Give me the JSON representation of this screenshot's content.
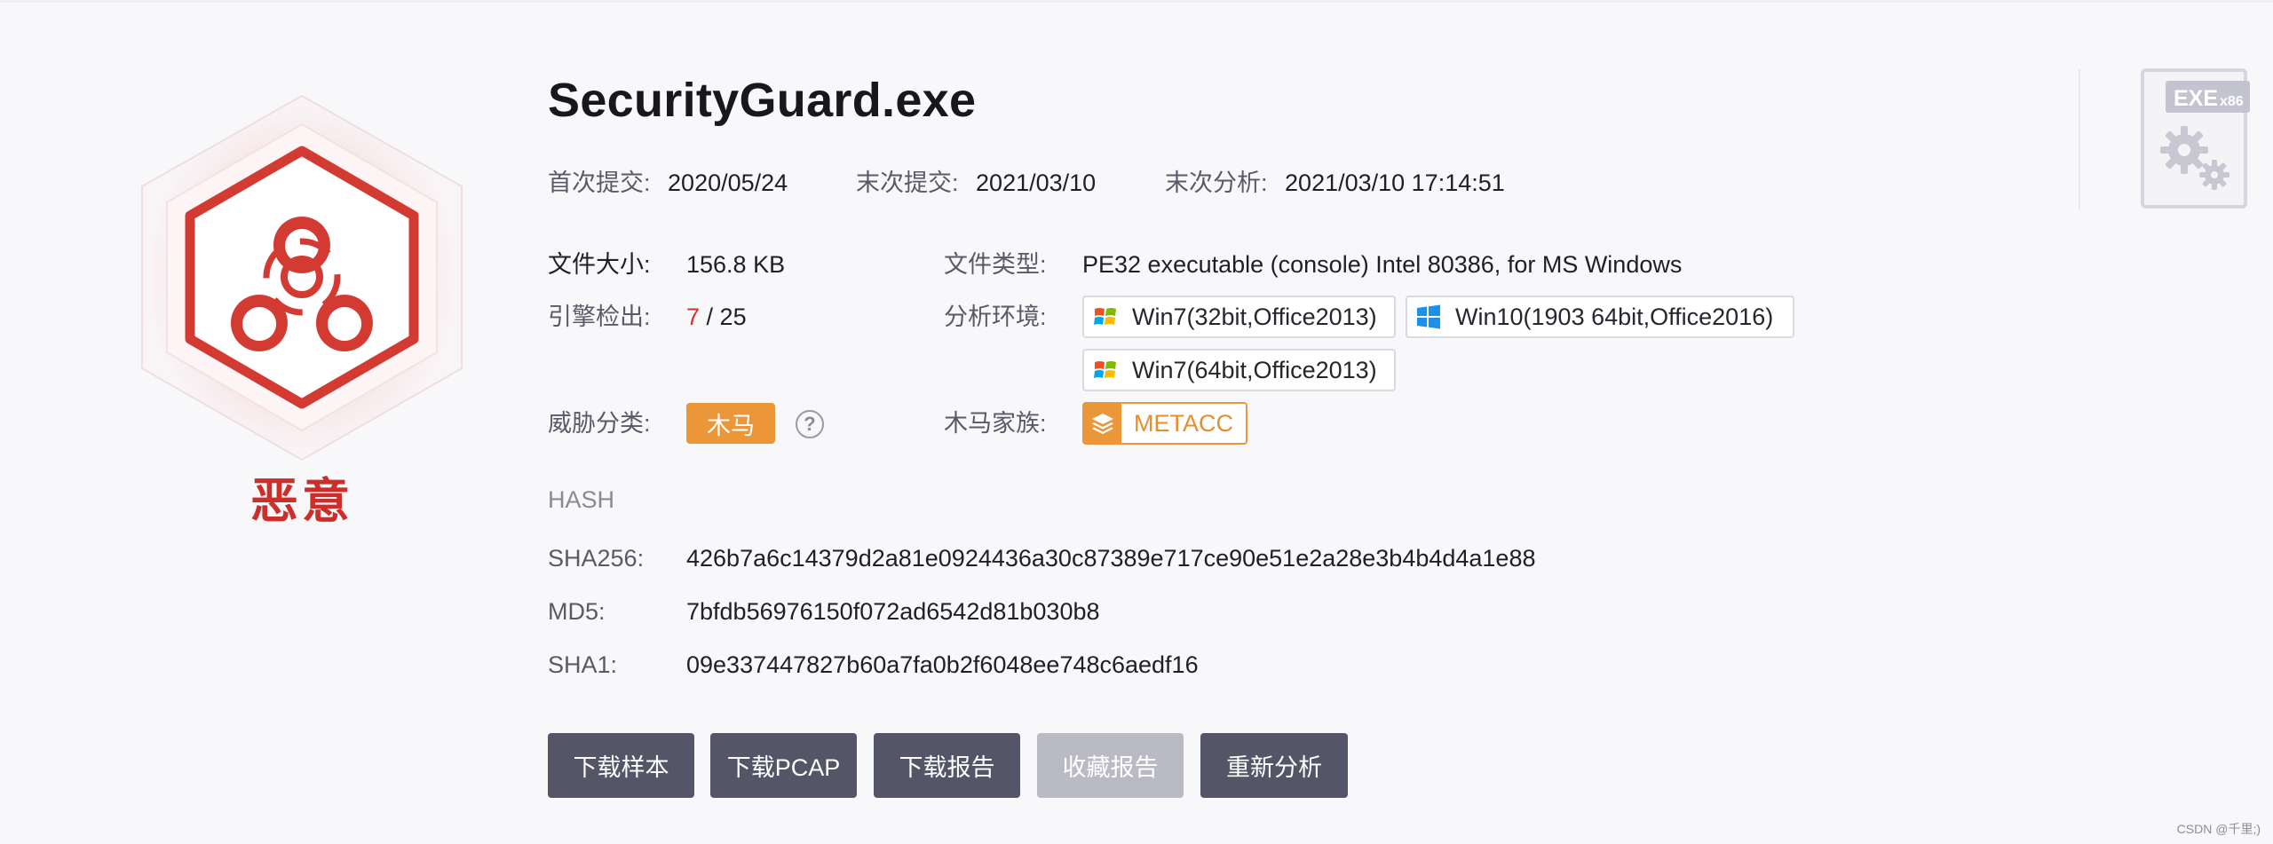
{
  "file": {
    "name": "SecurityGuard.exe"
  },
  "verdict": {
    "label": "恶意",
    "icon": "biohazard-icon",
    "color": "#cc2e2a"
  },
  "submission": {
    "first_label": "首次提交:",
    "first_value": "2020/05/24",
    "last_label": "末次提交:",
    "last_value": "2021/03/10",
    "analysis_label": "末次分析:",
    "analysis_value": "2021/03/10 17:14:51"
  },
  "details": {
    "size_label": "文件大小:",
    "size_value": "156.8 KB",
    "type_label": "文件类型:",
    "type_value": "PE32 executable (console) Intel 80386, for MS Windows",
    "engine_label": "引擎检出:",
    "engine_detected": "7",
    "engine_sep": " / ",
    "engine_total": "25",
    "env_label": "分析环境:",
    "environments": [
      {
        "label": "Win7(32bit,Office2013)",
        "icon": "windows7-icon"
      },
      {
        "label": "Win10(1903 64bit,Office2016)",
        "icon": "windows10-icon"
      },
      {
        "label": "Win7(64bit,Office2013)",
        "icon": "windows7-icon"
      }
    ],
    "threat_label": "威胁分类:",
    "threat_value": "木马",
    "threat_help": "?",
    "family_label": "木马家族:",
    "family_value": "METACC",
    "family_icon": "layers-icon"
  },
  "hash": {
    "heading": "HASH",
    "sha256_label": "SHA256:",
    "sha256": "426b7a6c14379d2a81e0924436a30c87389e717ce90e51e2a28e3b4b4d4a1e88",
    "md5_label": "MD5:",
    "md5": "7bfdb56976150f072ad6542d81b030b8",
    "sha1_label": "SHA1:",
    "sha1": "09e337447827b60a7fa0b2f6048ee748c6aedf16"
  },
  "actions": {
    "download_sample": "下载样本",
    "download_pcap": "下载PCAP",
    "download_report": "下载报告",
    "favorite_report": "收藏报告",
    "reanalyze": "重新分析"
  },
  "file_type_badge": {
    "main": "EXE",
    "sub": "x86",
    "icon": "gears-icon"
  },
  "watermark": "CSDN @千里;)",
  "colors": {
    "accent_orange": "#eb9638",
    "danger_red": "#d0332d",
    "button_dark": "#545566",
    "button_disabled": "#b9bac4"
  }
}
